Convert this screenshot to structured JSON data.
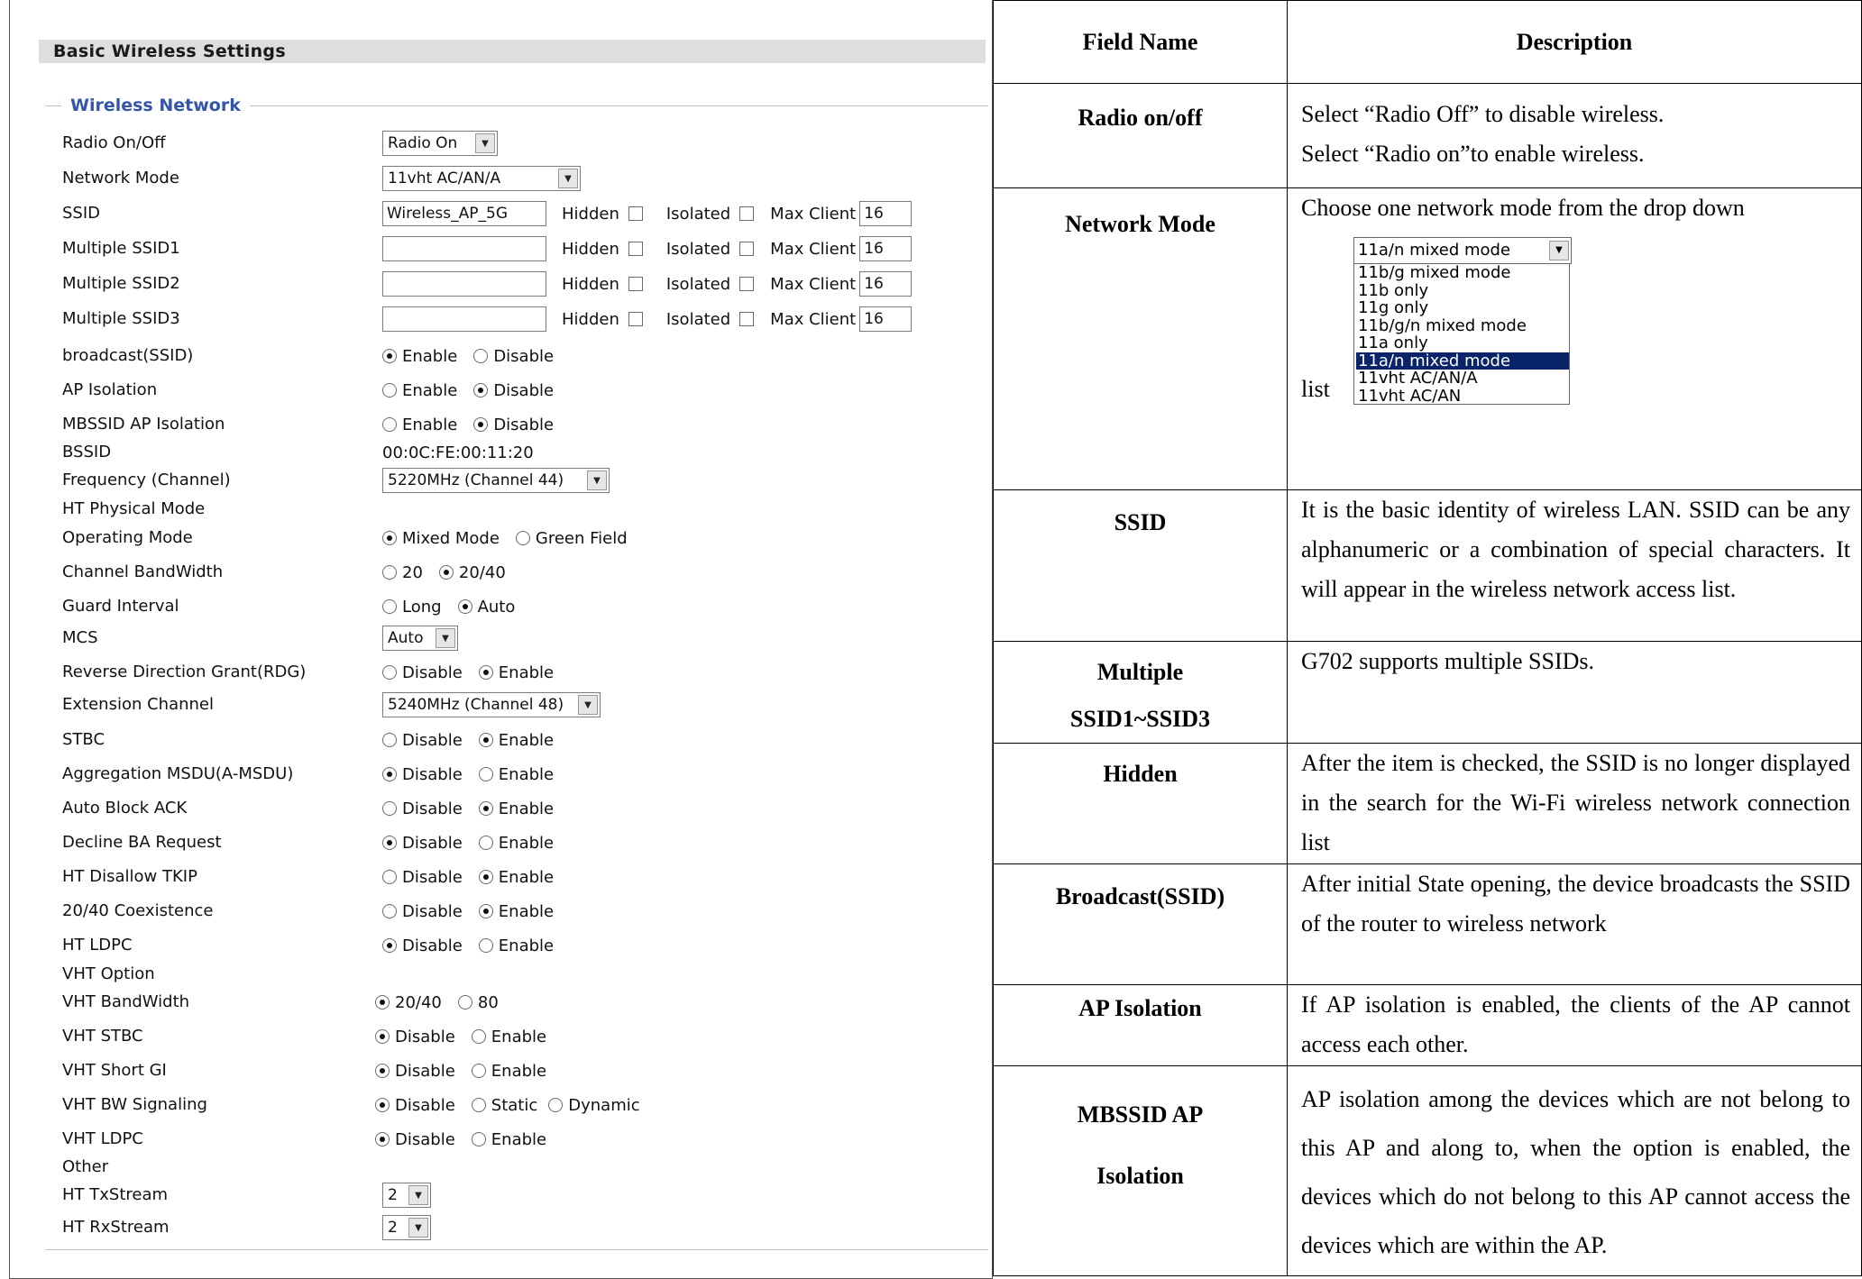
{
  "panel": {
    "title": "Basic Wireless Settings",
    "legend": "Wireless Network",
    "rows": {
      "radio_onoff": {
        "label": "Radio On/Off",
        "value": "Radio On"
      },
      "network_mode": {
        "label": "Network Mode",
        "value": "11vht AC/AN/A"
      },
      "ssid": {
        "label": "SSID",
        "value": "Wireless_AP_5G"
      },
      "mssid1": {
        "label": "Multiple SSID1",
        "value": ""
      },
      "mssid2": {
        "label": "Multiple SSID2",
        "value": ""
      },
      "mssid3": {
        "label": "Multiple SSID3",
        "value": ""
      },
      "broadcast": {
        "label": "broadcast(SSID)"
      },
      "ap_isolation": {
        "label": "AP Isolation"
      },
      "mbssid_isolation": {
        "label": "MBSSID AP Isolation"
      },
      "bssid": {
        "label": "BSSID",
        "value": "00:0C:FE:00:11:20"
      },
      "frequency": {
        "label": "Frequency (Channel)",
        "value": "5220MHz (Channel 44)"
      },
      "ht_physical": {
        "label": "HT Physical Mode"
      },
      "operating_mode": {
        "label": "Operating Mode"
      },
      "channel_bw": {
        "label": "Channel BandWidth"
      },
      "guard_interval": {
        "label": "Guard Interval"
      },
      "mcs": {
        "label": "MCS",
        "value": "Auto"
      },
      "rdg": {
        "label": "Reverse Direction Grant(RDG)"
      },
      "ext_channel": {
        "label": "Extension Channel",
        "value": "5240MHz (Channel 48)"
      },
      "stbc": {
        "label": "STBC"
      },
      "amsdu": {
        "label": "Aggregation MSDU(A-MSDU)"
      },
      "auto_block_ack": {
        "label": "Auto Block ACK"
      },
      "decline_ba": {
        "label": "Decline BA Request"
      },
      "disallow_tkip": {
        "label": "HT Disallow TKIP"
      },
      "coexistence": {
        "label": "20/40 Coexistence"
      },
      "ht_ldpc": {
        "label": "HT LDPC"
      },
      "vht_option": {
        "label": "VHT Option"
      },
      "vht_bw": {
        "label": "VHT BandWidth"
      },
      "vht_stbc": {
        "label": "VHT STBC"
      },
      "vht_short_gi": {
        "label": "VHT Short GI"
      },
      "vht_bw_signaling": {
        "label": "VHT BW Signaling"
      },
      "vht_ldpc": {
        "label": "VHT LDPC"
      },
      "other": {
        "label": "Other"
      },
      "tx_stream": {
        "label": "HT TxStream",
        "value": "2"
      },
      "rx_stream": {
        "label": "HT RxStream",
        "value": "2"
      }
    },
    "ssid_opts": {
      "hidden": "Hidden",
      "isolated": "Isolated",
      "max_client": "Max Client",
      "max_value": "16"
    },
    "opts": {
      "enable": "Enable",
      "disable": "Disable",
      "mixed": "Mixed Mode",
      "green": "Green Field",
      "bw20": "20",
      "bw2040": "20/40",
      "bw80": "80",
      "long": "Long",
      "auto": "Auto",
      "static": "Static",
      "dynamic": "Dynamic"
    }
  },
  "table": {
    "headers": [
      "Field Name",
      "Description"
    ],
    "rows": [
      {
        "name": "Radio on/off",
        "desc": [
          "Select “Radio Off” to disable wireless.",
          "Select “Radio on”to enable wireless."
        ]
      },
      {
        "name": "Network Mode",
        "desc": [
          "Choose one network mode from the drop down"
        ],
        "desc_after": "list"
      },
      {
        "name": "SSID",
        "desc": [
          "It is the basic identity of wireless LAN. SSID can be any alphanumeric or a combination of special characters. It will appear in the wireless network access list."
        ]
      },
      {
        "name_lines": [
          "Multiple",
          "SSID1~SSID3"
        ],
        "desc": [
          "G702 supports multiple SSIDs."
        ]
      },
      {
        "name": "Hidden",
        "desc": [
          "After the item is checked, the SSID is no longer displayed in the search for the Wi-Fi wireless network connection list"
        ]
      },
      {
        "name": "Broadcast(SSID)",
        "desc": [
          "After initial State opening, the device broadcasts the SSID of the router to wireless network"
        ]
      },
      {
        "name": "AP Isolation",
        "desc": [
          "If AP isolation is enabled, the clients of the AP cannot access each other."
        ]
      },
      {
        "name_lines": [
          "MBSSID AP",
          "Isolation"
        ],
        "desc": [
          "AP isolation among the devices which are not belong to this AP and along to, when the option is enabled, the devices which do not belong to this AP cannot access the devices which are within the AP."
        ]
      }
    ],
    "dropdown": {
      "selected": "11a/n mixed mode",
      "options": [
        "11b/g mixed mode",
        "11b only",
        "11g only",
        "11b/g/n mixed mode",
        "11a only",
        "11a/n mixed mode",
        "11vht AC/AN/A",
        "11vht AC/AN"
      ]
    }
  },
  "icons": {
    "select_arrow": "chevron-down-icon"
  }
}
